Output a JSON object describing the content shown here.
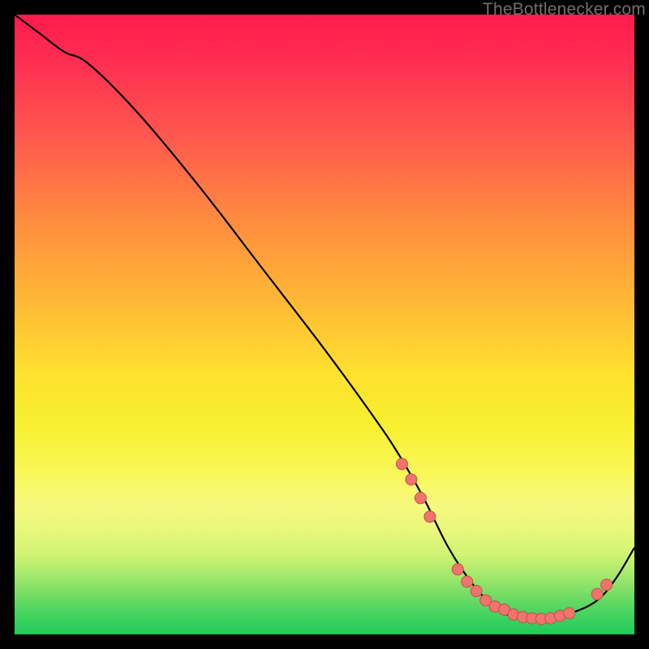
{
  "attribution": "TheBottlenecker.com",
  "colors": {
    "marker_fill": "#f0746e",
    "marker_stroke": "#c54f49",
    "curve": "#000000"
  },
  "chart_data": {
    "type": "line",
    "title": "",
    "xlabel": "",
    "ylabel": "",
    "xlim": [
      0,
      100
    ],
    "ylim": [
      0,
      100
    ],
    "series": [
      {
        "name": "curve",
        "x": [
          0,
          4,
          8,
          12,
          20,
          30,
          40,
          50,
          58,
          62,
          66,
          70,
          74,
          78,
          82,
          86,
          90,
          94,
          97,
          100
        ],
        "y": [
          100,
          97,
          94,
          92,
          84,
          72,
          59,
          46,
          35,
          29,
          22,
          14,
          8,
          4,
          2.5,
          2.5,
          3.5,
          5.5,
          9,
          14
        ]
      }
    ],
    "markers": [
      {
        "x": 62.5,
        "y": 27.5
      },
      {
        "x": 64.0,
        "y": 25.0
      },
      {
        "x": 65.5,
        "y": 22.0
      },
      {
        "x": 67.0,
        "y": 19.0
      },
      {
        "x": 71.5,
        "y": 10.5
      },
      {
        "x": 73.0,
        "y": 8.5
      },
      {
        "x": 74.5,
        "y": 7.0
      },
      {
        "x": 76.0,
        "y": 5.5
      },
      {
        "x": 77.5,
        "y": 4.5
      },
      {
        "x": 79.0,
        "y": 4.0
      },
      {
        "x": 80.5,
        "y": 3.2
      },
      {
        "x": 82.0,
        "y": 2.8
      },
      {
        "x": 83.5,
        "y": 2.6
      },
      {
        "x": 85.0,
        "y": 2.5
      },
      {
        "x": 86.5,
        "y": 2.6
      },
      {
        "x": 88.0,
        "y": 3.0
      },
      {
        "x": 89.5,
        "y": 3.4
      },
      {
        "x": 94.0,
        "y": 6.5
      },
      {
        "x": 95.5,
        "y": 8.0
      }
    ]
  }
}
